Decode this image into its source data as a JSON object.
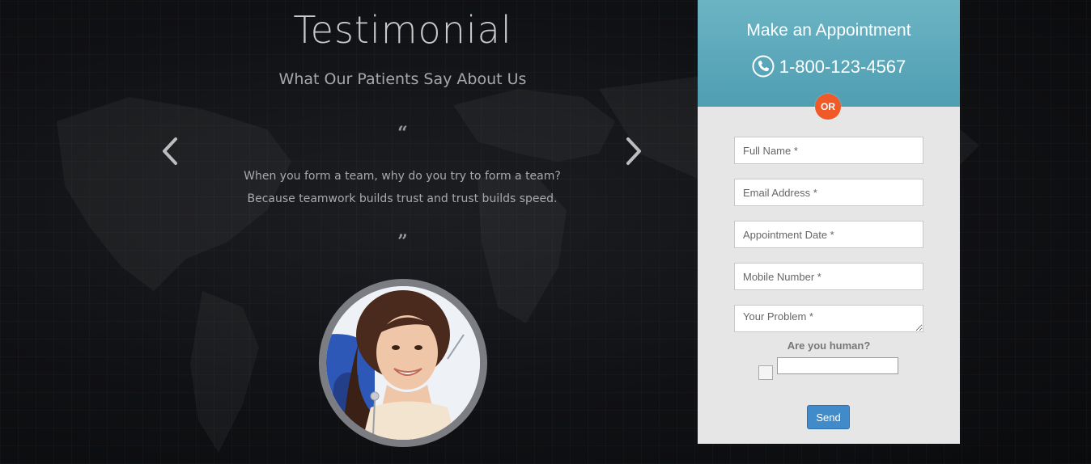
{
  "testimonial": {
    "title": "Testimonial",
    "subtitle": "What Our Patients Say About Us",
    "quote_open": "“",
    "quote_close": "”",
    "text": "When you form a team, why do you try to form a team? Because teamwork builds trust and trust builds speed.",
    "prev_icon": "chevron-left-icon",
    "next_icon": "chevron-right-icon"
  },
  "appointment": {
    "title": "Make an Appointment",
    "phone": "1-800-123-4567",
    "phone_icon": "phone-icon",
    "or_label": "OR",
    "fields": {
      "full_name": "Full Name *",
      "email": "Email Address *",
      "date": "Appointment Date *",
      "mobile": "Mobile Number *",
      "problem": "Your Problem *"
    },
    "human_label": "Are you human?",
    "send_label": "Send"
  },
  "colors": {
    "header_teal": "#5aa9bb",
    "or_orange": "#f05a28",
    "send_blue": "#428bca"
  }
}
